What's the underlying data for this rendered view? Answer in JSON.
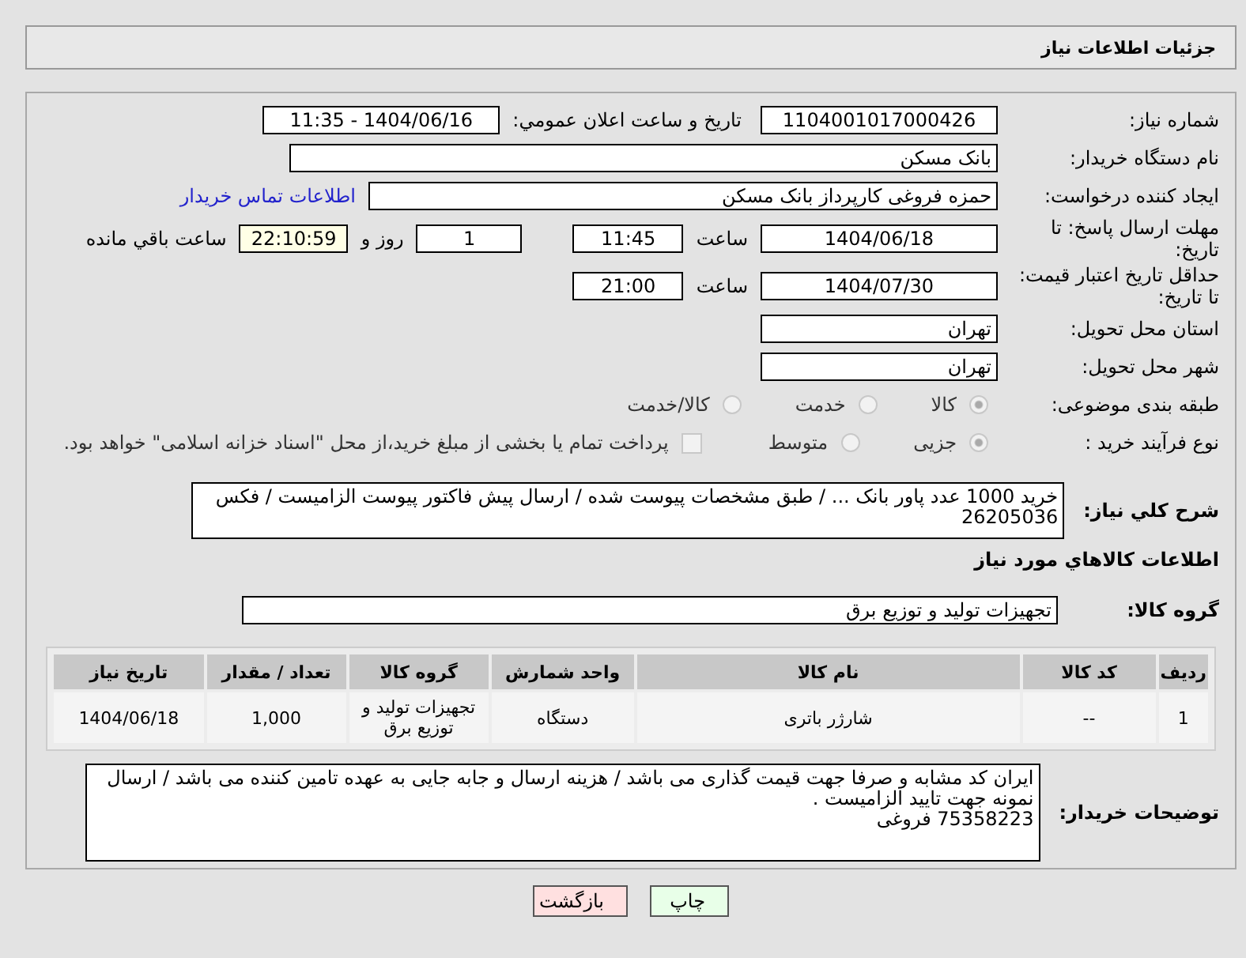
{
  "header": {
    "title": "جزئیات اطلاعات نیاز"
  },
  "need_number": {
    "label": "شماره نیاز:",
    "value": "1104001017000426"
  },
  "announce": {
    "label": "تاریخ و ساعت اعلان عمومي:",
    "value": "1404/06/16 - 11:35"
  },
  "buyer_org": {
    "label": "نام دستگاه خریدار:",
    "value": "بانک مسکن"
  },
  "requester": {
    "label": "ایجاد کننده درخواست:",
    "value": "حمزه فروغی کارپرداز بانک مسکن",
    "link": "اطلاعات تماس خریدار"
  },
  "reply_deadline": {
    "label": "مهلت ارسال پاسخ: تا تاریخ:",
    "date": "1404/06/18",
    "time_label": "ساعت",
    "time": "11:45",
    "days": "1",
    "days_label": "روز و",
    "remaining": "22:10:59",
    "remaining_label": "ساعت باقي مانده"
  },
  "price_validity": {
    "label": "حداقل تاریخ اعتبار قیمت: تا تاریخ:",
    "date": "1404/07/30",
    "time_label": "ساعت",
    "time": "21:00"
  },
  "province": {
    "label": "استان محل تحویل:",
    "value": "تهران"
  },
  "city": {
    "label": "شهر محل تحویل:",
    "value": "تهران"
  },
  "category": {
    "label": "طبقه بندی موضوعی:",
    "options": [
      {
        "label": "کالا",
        "selected": true
      },
      {
        "label": "خدمت",
        "selected": false
      },
      {
        "label": "کالا/خدمت",
        "selected": false
      }
    ]
  },
  "process": {
    "label": "نوع فرآیند خرید :",
    "options": [
      {
        "label": "جزیی",
        "selected": true
      },
      {
        "label": "متوسط",
        "selected": false
      }
    ],
    "treasury": {
      "label": "پرداخت تمام یا بخشی از مبلغ خرید،از محل \"اسناد خزانه اسلامی\" خواهد بود.",
      "checked": false
    }
  },
  "description": {
    "label": "شرح کلي نیاز:",
    "value": "خرید 1000 عدد پاور بانک ... / طبق مشخصات پیوست شده / ارسال پیش فاکتور پیوست الزامیست / فکس 26205036"
  },
  "goods_heading": "اطلاعات کالاهاي مورد نیاز",
  "goods_group": {
    "label": "گروه کالا:",
    "value": "تجهیزات تولید و توزیع برق"
  },
  "table": {
    "columns": [
      "ردیف",
      "کد کالا",
      "نام کالا",
      "واحد شمارش",
      "گروه کالا",
      "تعداد / مقدار",
      "تاریخ نیاز"
    ],
    "rows": [
      [
        "1",
        "--",
        "شارژر باتری",
        "دستگاه",
        "تجهیزات تولید و توزیع برق",
        "1,000",
        "1404/06/18"
      ]
    ]
  },
  "buyer_notes": {
    "label": "توضیحات خریدار:",
    "value": "ایران کد مشابه و صرفا جهت قیمت گذاری می باشد / هزینه ارسال و جابه جایی به عهده تامین کننده می باشد / ارسال نمونه جهت تایید الزامیست .\n75358223 فروغی"
  },
  "buttons": [
    {
      "label": "چاپ",
      "kind": "print"
    },
    {
      "label": "بازگشت",
      "kind": "back"
    }
  ]
}
